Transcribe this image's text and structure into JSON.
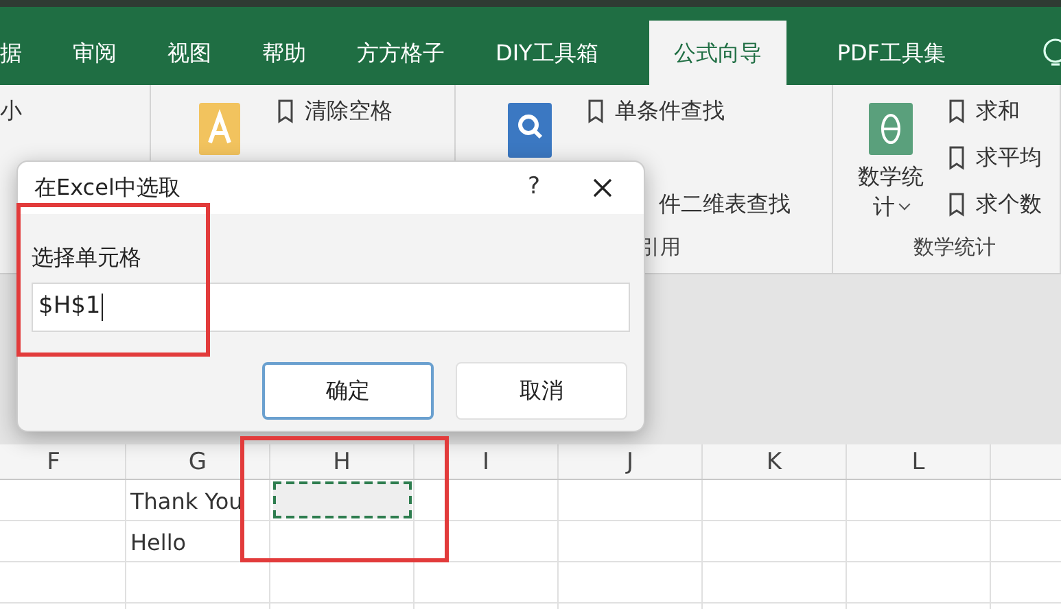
{
  "tabs": [
    {
      "label": "据",
      "selected": false
    },
    {
      "label": "审阅",
      "selected": false
    },
    {
      "label": "视图",
      "selected": false
    },
    {
      "label": "帮助",
      "selected": false
    },
    {
      "label": "方方格子",
      "selected": false
    },
    {
      "label": "DIY工具箱",
      "selected": false
    },
    {
      "label": "公式向导",
      "selected": true
    },
    {
      "label": "PDF工具集",
      "selected": false
    }
  ],
  "ribbon": {
    "groups": [
      {
        "kind": "list",
        "items": [
          {
            "label": "小",
            "kind": "command"
          }
        ]
      },
      {
        "kind": "large",
        "large": {
          "kind": "text"
        },
        "items": [
          {
            "label": "清除空格",
            "kind": "command"
          }
        ]
      },
      {
        "kind": "large",
        "large": {
          "kind": "search"
        },
        "items": [
          {
            "label": "单条件查找",
            "kind": "command"
          },
          {
            "label": "件二维表查找",
            "kind": "clipped"
          }
        ],
        "label": "引用"
      },
      {
        "kind": "large",
        "large": {
          "kind": "theta",
          "lines": [
            "数学统",
            "计"
          ]
        },
        "items": [
          {
            "label": "求和",
            "kind": "command"
          },
          {
            "label": "求平均",
            "kind": "command"
          },
          {
            "label": "求个数",
            "kind": "command"
          }
        ],
        "label": "数学统计"
      }
    ]
  },
  "dialog": {
    "title": "在Excel中选取",
    "help": "?",
    "field_label": "选择单元格",
    "value": "$H$1",
    "buttons": [
      {
        "label": "确定",
        "kind": "primary"
      },
      {
        "label": "取消",
        "kind": "secondary"
      }
    ]
  },
  "sheet": {
    "columns": [
      "F",
      "G",
      "H",
      "I",
      "J",
      "K",
      "L"
    ],
    "rows": [
      {
        "cells": [
          {},
          {
            "text": "Thank You"
          },
          {
            "marquee": true
          },
          {},
          {},
          {},
          {}
        ]
      },
      {
        "cells": [
          {},
          {
            "text": "Hello"
          },
          {},
          {},
          {},
          {},
          {}
        ]
      },
      {
        "cells": [
          {},
          {},
          {},
          {},
          {},
          {},
          {}
        ]
      },
      {
        "cells": [
          {},
          {},
          {},
          {},
          {},
          {},
          {}
        ]
      }
    ]
  }
}
